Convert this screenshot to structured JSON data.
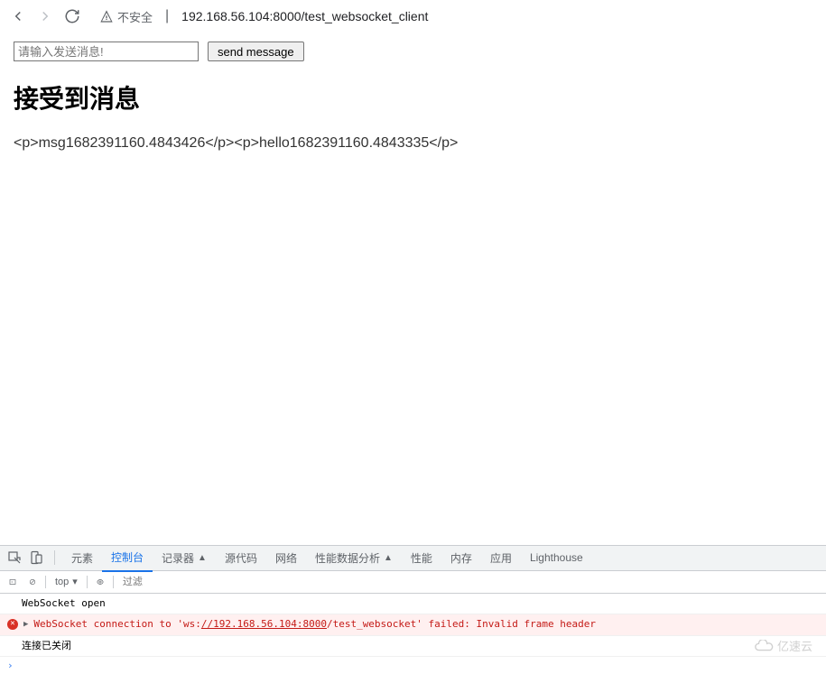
{
  "browser": {
    "security_label": "不安全",
    "url": "192.168.56.104:8000/test_websocket_client"
  },
  "page": {
    "input_placeholder": "请输入发送消息!",
    "button_label": "send message",
    "heading": "接受到消息",
    "message_text": "<p>msg1682391160.4843426</p><p>hello1682391160.4843335</p>"
  },
  "devtools": {
    "tabs": {
      "elements": "元素",
      "console": "控制台",
      "recorder": "记录器",
      "sources": "源代码",
      "network": "网络",
      "performance": "性能数据分析",
      "performance2": "性能",
      "memory": "内存",
      "application": "应用",
      "lighthouse": "Lighthouse"
    },
    "toolbar": {
      "context": "top",
      "filter_placeholder": "过滤"
    },
    "console": {
      "line1": "WebSocket open",
      "error_prefix": "WebSocket connection to '",
      "error_url_scheme": "ws:",
      "error_url_host": "//192.168.56.104:8000",
      "error_url_path": "/test_websocket' failed: Invalid frame header",
      "line3": "连接已关闭"
    }
  },
  "watermark": "亿速云"
}
